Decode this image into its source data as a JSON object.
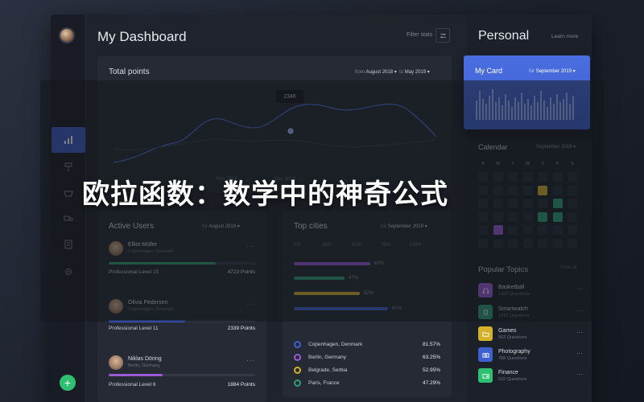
{
  "header": {
    "title": "My Dashboard",
    "filter_label": "Filter stats"
  },
  "total_points": {
    "title": "Total points",
    "from_label": "from",
    "from_value": "August 2018 ▾",
    "to_label": "to",
    "to_value": "May 2019 ▾",
    "tooltip": "2346",
    "x_labels": [
      "Nov 2018",
      "Dec 2018"
    ]
  },
  "active_users": {
    "title": "Active Users",
    "for_label": "for",
    "for_value": "August 2019 ▾",
    "users": [
      {
        "name": "Elliot Müller",
        "location": "Copenhagen, Denmark",
        "level": "Professional Level 15",
        "points": "4723 Points",
        "progress": 0.73,
        "color": "#2f9e74"
      },
      {
        "name": "Olivia Pedersen",
        "location": "Copenhagen, Denmark",
        "level": "Professional Level 11",
        "points": "2339 Points",
        "progress": 0.52,
        "color": "#3d5fcf"
      },
      {
        "name": "Niklas Döring",
        "location": "Berlin, Germany",
        "level": "Professional Level 6",
        "points": "1884 Points",
        "progress": 0.37,
        "color": "#9b5ad6"
      }
    ],
    "more": "···"
  },
  "top_cities": {
    "title": "Top cities",
    "for_label": "for",
    "for_value": "September 2019 ▾",
    "axis": [
      "0%",
      "25%",
      "50%",
      "75%",
      "100%"
    ],
    "bars": [
      {
        "pct": 63,
        "label": "63%",
        "color": "#9b5ad6"
      },
      {
        "pct": 47,
        "label": "47%",
        "color": "#2f9e74"
      },
      {
        "pct": 52,
        "label": "52%",
        "color": "#d6b22c"
      },
      {
        "pct": 81,
        "label": "81%",
        "color": "#3d5fcf"
      }
    ],
    "legend": [
      {
        "name": "Copenhagen, Denmark",
        "value": "81.57%",
        "color": "#3d5fcf"
      },
      {
        "name": "Berlin, Germany",
        "value": "63.25%",
        "color": "#9b5ad6"
      },
      {
        "name": "Belgrade, Serbia",
        "value": "52.95%",
        "color": "#d6b22c"
      },
      {
        "name": "Paris, France",
        "value": "47.29%",
        "color": "#2f9e74"
      }
    ]
  },
  "personal": {
    "title": "Personal",
    "learn_more": "Learn more",
    "my_card": {
      "title": "My Card",
      "for_label": "for",
      "for_value": "September 2019 ▾"
    }
  },
  "calendar": {
    "title": "Calendar",
    "month": "September 2019 ▾",
    "weekdays": [
      "S",
      "M",
      "T",
      "W",
      "T",
      "F",
      "S"
    ],
    "rows": [
      [
        "",
        "",
        "",
        "",
        "",
        "",
        ""
      ],
      [
        "",
        "",
        "",
        "",
        "",
        "",
        ""
      ],
      [
        "",
        "",
        "",
        "",
        "",
        "",
        ""
      ],
      [
        "",
        "",
        "",
        "",
        "",
        "",
        ""
      ],
      [
        "",
        "",
        "",
        "",
        "",
        "",
        ""
      ],
      [
        "",
        "",
        "",
        "",
        "",
        "",
        ""
      ]
    ]
  },
  "popular_topics": {
    "title": "Popular Topics",
    "view_all": "View all",
    "items": [
      {
        "name": "Basketball",
        "sub": "1422 Questions",
        "color": "#9b5ad6",
        "icon": "headphones-icon"
      },
      {
        "name": "Smartwatch",
        "sub": "1233 Questions",
        "color": "#2f9e74",
        "icon": "watch-icon"
      },
      {
        "name": "Games",
        "sub": "963 Questions",
        "color": "#d6b22c",
        "icon": "folder-icon"
      },
      {
        "name": "Photography",
        "sub": "788 Questions",
        "color": "#3d5fcf",
        "icon": "camera-icon"
      },
      {
        "name": "Finance",
        "sub": "632 Questions",
        "color": "#2fbf71",
        "icon": "wallet-icon"
      }
    ]
  },
  "overlay": {
    "headline": "欧拉函数：数学中的神奇公式"
  },
  "colors": {
    "accent": "#3c5bc6",
    "background": "#1f232c"
  }
}
